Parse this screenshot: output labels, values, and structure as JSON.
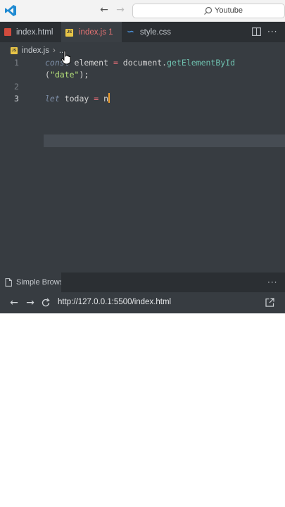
{
  "titlebar": {
    "search_text": "Youtube"
  },
  "tabs": [
    {
      "label": "index.html",
      "icon": "html-file-icon"
    },
    {
      "label": "index.js 1",
      "icon": "js-file-icon"
    },
    {
      "label": "style.css",
      "icon": "css-file-icon"
    }
  ],
  "breadcrumb": {
    "file": "index.js",
    "rest": "..."
  },
  "editor": {
    "line_numbers": [
      "1",
      "2",
      "3"
    ],
    "line1": {
      "kw": "const",
      "name": " element ",
      "eq": "=",
      "obj": " document.",
      "fn": "getElementById"
    },
    "line1_wrap": {
      "open": "(",
      "str": "\"date\"",
      "close": ");"
    },
    "line3": {
      "kw": "let",
      "name": " today ",
      "eq": "=",
      "rest": " n"
    }
  },
  "panel": {
    "tab_label": "Simple Browser"
  },
  "browser": {
    "url": "http://127.0.0.1:5500/index.html"
  },
  "colors": {
    "editor_bg": "#373c41",
    "tabbar_bg": "#2b2f33",
    "active_tab_label": "#e57373",
    "keyword": "#7e8fa8",
    "function": "#6fc2b0",
    "string": "#b5e07a"
  }
}
